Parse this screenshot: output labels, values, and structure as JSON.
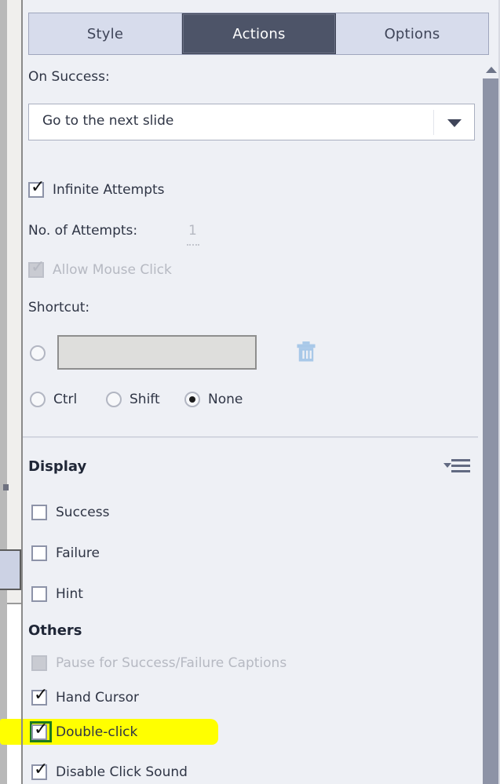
{
  "tabs": [
    {
      "label": "Style",
      "active": false
    },
    {
      "label": "Actions",
      "active": true
    },
    {
      "label": "Options",
      "active": false
    }
  ],
  "on_success": {
    "label": "On Success:",
    "value": "Go to the next slide",
    "arrow_icon": "chevron-down-icon"
  },
  "attempts": {
    "infinite_label": "Infinite Attempts",
    "infinite_checked": true,
    "count_label": "No. of Attempts:",
    "count_value": "1",
    "allow_mouse_click_label": "Allow Mouse Click",
    "allow_mouse_click_checked": true
  },
  "shortcut": {
    "label": "Shortcut:",
    "field_value": "",
    "delete_icon": "trash-icon",
    "modifiers": [
      {
        "label": "Ctrl",
        "selected": false
      },
      {
        "label": "Shift",
        "selected": false
      },
      {
        "label": "None",
        "selected": true
      }
    ]
  },
  "display": {
    "header": "Display",
    "menu_icon": "hamburger-menu-icon",
    "items": [
      {
        "label": "Success",
        "checked": false
      },
      {
        "label": "Failure",
        "checked": false
      },
      {
        "label": "Hint",
        "checked": false
      }
    ]
  },
  "others": {
    "header": "Others",
    "items": [
      {
        "label": "Pause for Success/Failure Captions",
        "checked": false,
        "disabled": true
      },
      {
        "label": "Hand Cursor",
        "checked": true,
        "disabled": false
      },
      {
        "label": "Double-click",
        "checked": true,
        "disabled": false,
        "highlighted": true
      },
      {
        "label": "Disable Click Sound",
        "checked": true,
        "disabled": false
      }
    ]
  },
  "colors": {
    "panel_bg": "#eef0f5",
    "tab_inactive": "#d7dcec",
    "tab_active": "#4d5468",
    "highlight": "#ffff00",
    "highlight_box": "#1d7a1d",
    "scrollbar": "#8d93a6"
  }
}
